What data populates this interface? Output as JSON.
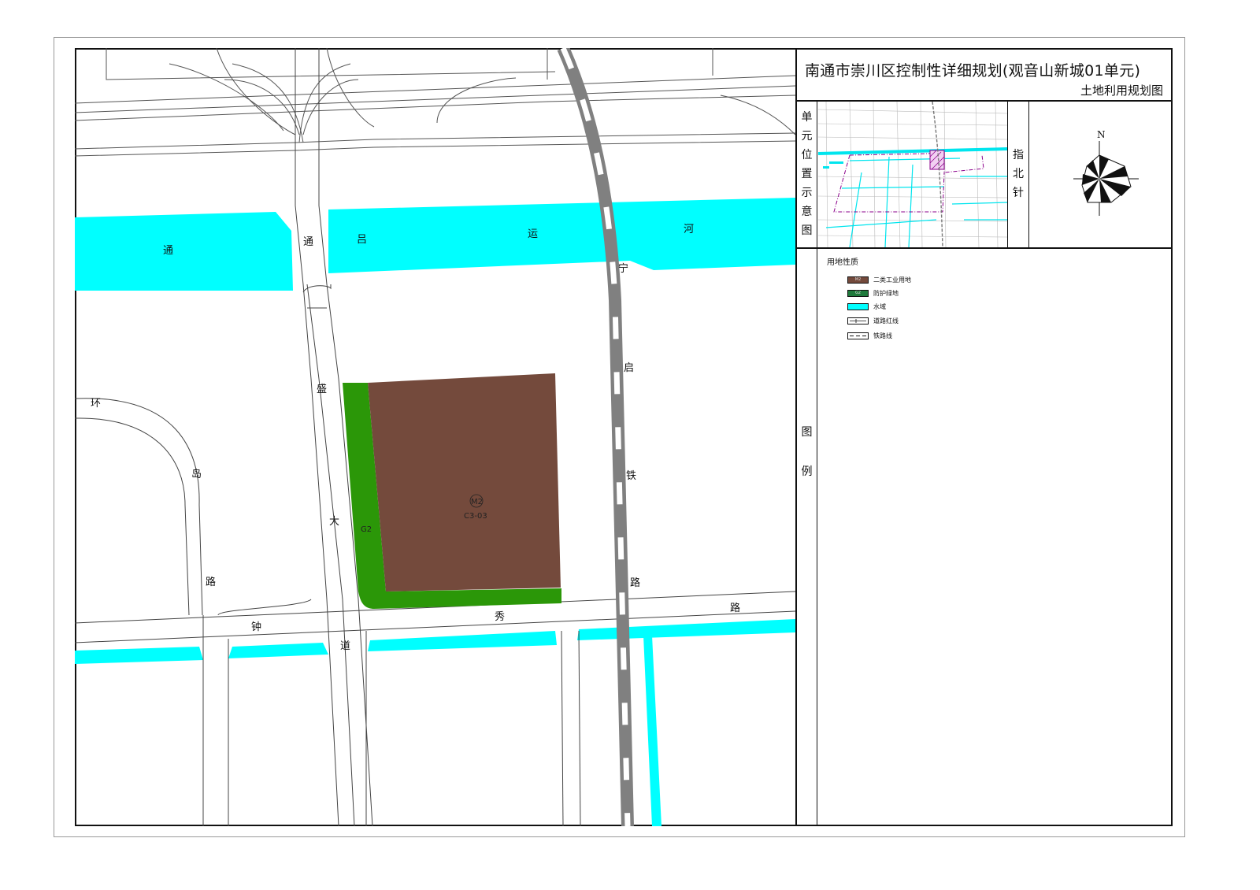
{
  "title": {
    "main": "南通市崇川区控制性详细规划(观音山新城01单元)",
    "sub": "土地利用规划图"
  },
  "panels": {
    "position_label": [
      "单",
      "元",
      "位",
      "置",
      "示",
      "意",
      "图"
    ],
    "north_label": [
      "指",
      "北",
      "针"
    ],
    "north_letter": "N",
    "legend_label": [
      "图",
      "例"
    ]
  },
  "legend": {
    "title": "用地性质",
    "items": [
      {
        "code": "M2",
        "label": "二类工业用地",
        "color": "#744a3c"
      },
      {
        "code": "G2",
        "label": "防护绿地",
        "color": "#1f7a3c"
      },
      {
        "code": "",
        "label": "水域",
        "color": "#00ffff"
      },
      {
        "code": "",
        "label": "道路红线",
        "color": "#ffffff"
      },
      {
        "code": "",
        "label": "铁路线",
        "color": "#ffffff"
      }
    ]
  },
  "map_labels": {
    "canal": [
      "通",
      "吕",
      "运",
      "河"
    ],
    "canal_west": "通",
    "tongsheng": [
      "通",
      "盛",
      "大",
      "道"
    ],
    "railway": [
      "宁",
      "启",
      "铁",
      "路"
    ],
    "huandao": [
      "环",
      "岛",
      "路"
    ],
    "zhongxiu": [
      "钟",
      "秀",
      "路"
    ],
    "parcel_code": "M2",
    "parcel_id": "C3-03",
    "green_code": "G2"
  },
  "colors": {
    "industrial": "#744a3c",
    "green": "#2b9708",
    "water": "#00ffff",
    "rail": "#808080"
  }
}
